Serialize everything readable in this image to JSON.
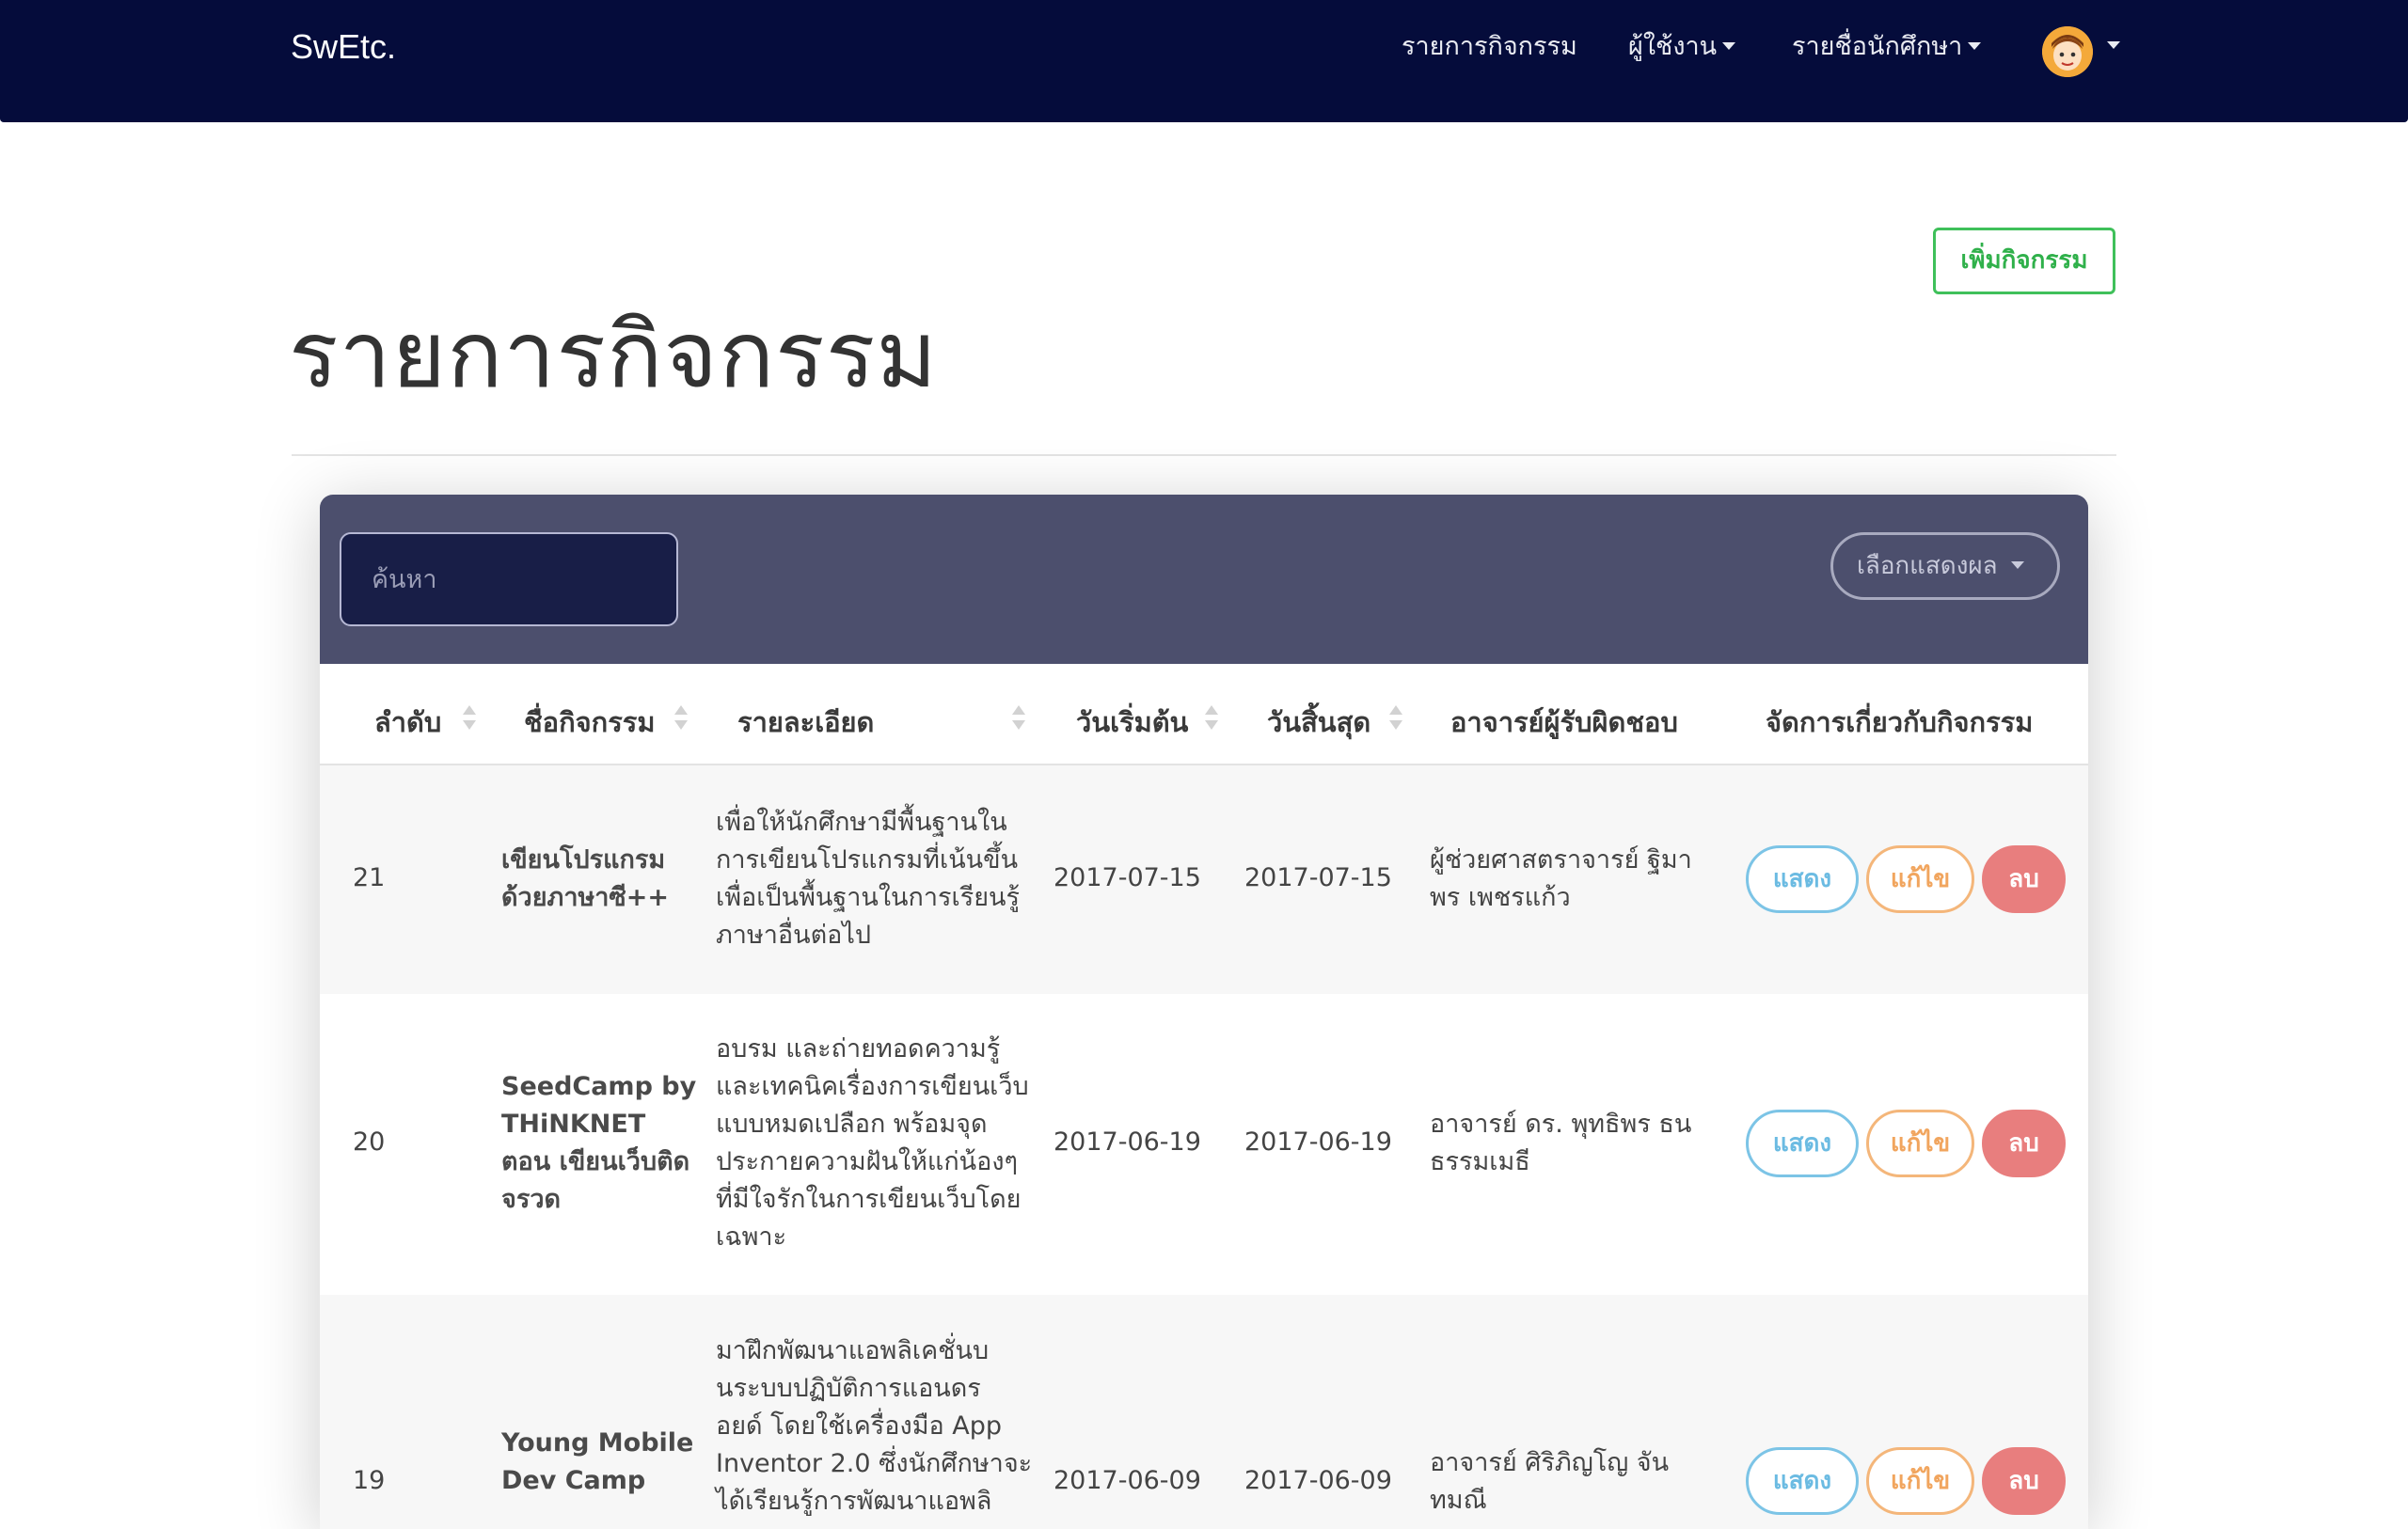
{
  "navbar": {
    "brand": "SwEtc.",
    "items": [
      {
        "label": "รายการกิจกรรม"
      },
      {
        "label": "ผู้ใช้งาน"
      },
      {
        "label": "รายชื่อนักศึกษา"
      }
    ]
  },
  "header": {
    "title": "รายการกิจกรรม",
    "add_button": "เพิ่มกิจกรรม"
  },
  "toolbar": {
    "search_placeholder": "ค้นหา",
    "display_select": "เลือกแสดงผล"
  },
  "table": {
    "columns": [
      "ลำดับ",
      "ชื่อกิจกรรม",
      "รายละเอียด",
      "วันเริ่มต้น",
      "วันสิ้นสุด",
      "อาจารย์ผู้รับผิดชอบ",
      "จัดการเกี่ยวกับกิจกรรม"
    ],
    "rows": [
      {
        "id": "21",
        "name": [
          "เขียนโปรแกรม",
          "ด้วยภาษาซี++"
        ],
        "detail": [
          "เพื่อให้นักศึกษามีพื้นฐานใน",
          "การเขียนโปรแกรมที่เน้นขึ้น",
          "เพื่อเป็นพื้นฐานในการเรียนรู้",
          "ภาษาอื่นต่อไป"
        ],
        "start": "2017-07-15",
        "end": "2017-07-15",
        "teacher": [
          "ผู้ช่วยศาสตราจารย์ ฐิมา",
          "พร เพชรแก้ว"
        ]
      },
      {
        "id": "20",
        "name": [
          "SeedCamp by",
          "THiNKNET",
          "ตอน เขียนเว็บติด",
          "จรวด"
        ],
        "detail": [
          "อบรม และถ่ายทอดความรู้",
          "และเทคนิคเรื่องการเขียนเว็บ",
          "แบบหมดเปลือก พร้อมจุด",
          "ประกายความฝันให้แก่น้องๆ",
          "ที่มีใจรักในการเขียนเว็บโดย",
          "เฉพาะ"
        ],
        "start": "2017-06-19",
        "end": "2017-06-19",
        "teacher": [
          "อาจารย์ ดร. พุทธิพร ธน",
          "ธรรมเมธี"
        ]
      },
      {
        "id": "19",
        "name": [
          "Young Mobile",
          "Dev Camp"
        ],
        "detail": [
          "มาฝึกพัฒนาแอพลิเคชั่นบ",
          "นระบบปฏิบัติการแอนดร",
          "อยด์ โดยใช้เครื่องมือ App",
          "Inventor 2.0  ซึ่งนักศึกษาจะ",
          "ได้เรียนรู้การพัฒนาแอพลิ"
        ],
        "start": "2017-06-09",
        "end": "2017-06-09",
        "teacher": [
          "อาจารย์ ศิริภิญโญ จัน",
          "ทมณี"
        ]
      }
    ],
    "actions": {
      "show": "แสดง",
      "edit": "แก้ไข",
      "delete": "ลบ"
    }
  },
  "colors": {
    "navbar": "#050c3b",
    "card_header": "#4c4f6d",
    "add_green": "#3fc05a",
    "show_blue": "#7cc4e6",
    "edit_orange": "#f4b67a",
    "delete_red": "#e87e7e"
  }
}
